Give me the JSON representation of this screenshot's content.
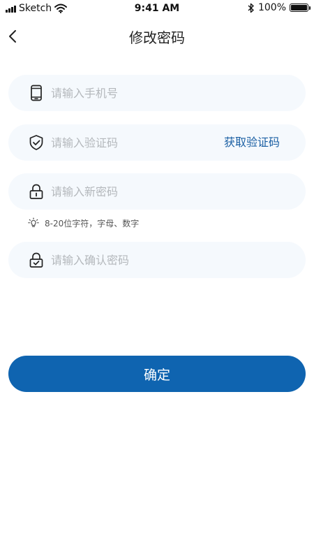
{
  "status_bar": {
    "carrier": "Sketch",
    "time": "9:41 AM",
    "battery": "100%"
  },
  "nav": {
    "title": "修改密码"
  },
  "form": {
    "phone": {
      "placeholder": "请输入手机号",
      "value": ""
    },
    "code": {
      "placeholder": "请输入验证码",
      "value": "",
      "button_label": "获取验证码"
    },
    "new_password": {
      "placeholder": "请输入新密码",
      "value": ""
    },
    "hint": "8-20位字符，字母、数字",
    "confirm_password": {
      "placeholder": "请输入确认密码",
      "value": ""
    },
    "submit_label": "确定"
  },
  "colors": {
    "accent": "#0f64b0",
    "link": "#1a5fa3",
    "field_bg": "#f5f9fd",
    "placeholder": "#b4b8bc"
  },
  "icons": [
    "signal-icon",
    "wifi-icon",
    "bluetooth-icon",
    "battery-icon",
    "back-icon",
    "phone-icon",
    "shield-check-icon",
    "lock-icon",
    "lightbulb-icon",
    "lock-check-icon"
  ]
}
